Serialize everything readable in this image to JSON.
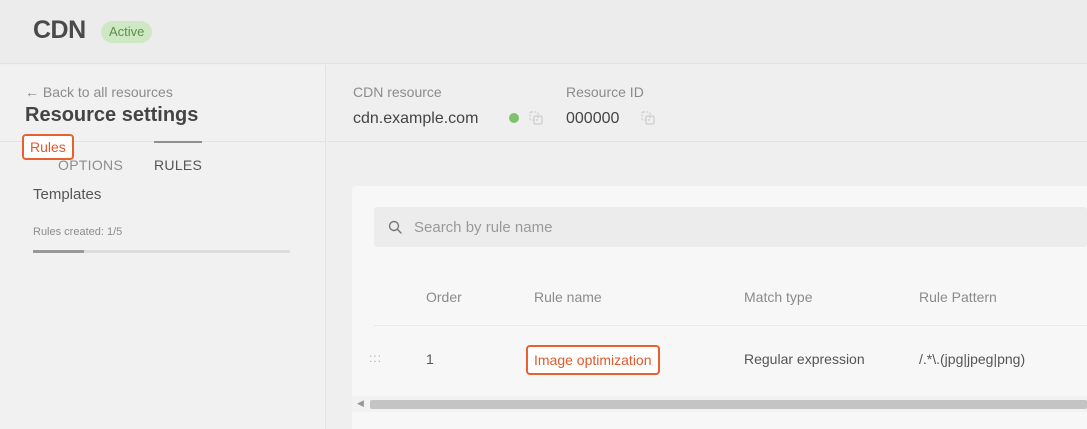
{
  "header": {
    "title": "CDN",
    "status": "Active"
  },
  "sidebar": {
    "back_link": "← Back to all resources",
    "title": "Resource settings",
    "tabs": [
      {
        "label": "OPTIONS",
        "active": false
      },
      {
        "label": "RULES",
        "active": true
      }
    ],
    "nav": [
      {
        "label": "Rules",
        "selected": true
      },
      {
        "label": "Templates",
        "selected": false
      }
    ],
    "rules_created": "Rules created: 1/5",
    "rules_progress": 0.2
  },
  "resource": {
    "cdn_label": "CDN resource",
    "cdn_value": "cdn.example.com",
    "id_label": "Resource ID",
    "id_value": "000000"
  },
  "rules_table": {
    "search_placeholder": "Search by rule name",
    "columns": [
      "Order",
      "Rule name",
      "Match type",
      "Rule Pattern"
    ],
    "rows": [
      {
        "handle": ":::",
        "order": "1",
        "name": "Image optimization",
        "match_type": "Regular expression",
        "pattern": "/.*\\.(jpg|jpeg|png)"
      }
    ]
  },
  "colors": {
    "accent": "#e8602f",
    "status_green": "#7ec26b",
    "badge_bg": "#cfe8c4"
  },
  "icons": [
    "copy-icon",
    "search-icon",
    "drag-handle-icon",
    "chevron-left-icon"
  ]
}
